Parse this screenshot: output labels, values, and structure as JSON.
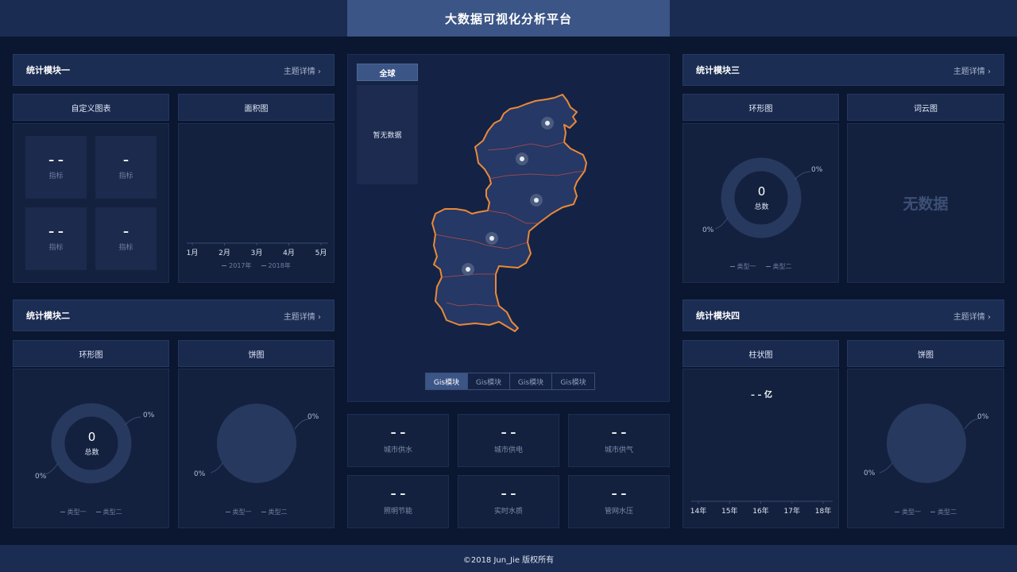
{
  "header": {
    "title": "大数据可视化分析平台"
  },
  "footer": {
    "copyright": "©2018 Jun_Jie 版权所有"
  },
  "detail_label": "主题详情",
  "modules": {
    "one": {
      "title": "统计模块一"
    },
    "two": {
      "title": "统计模块二"
    },
    "three": {
      "title": "统计模块三"
    },
    "four": {
      "title": "统计模块四"
    }
  },
  "custom_chart": {
    "title": "自定义图表",
    "metrics": [
      {
        "value": "– –",
        "label": "指标"
      },
      {
        "value": "–",
        "label": "指标"
      },
      {
        "value": "– –",
        "label": "指标"
      },
      {
        "value": "–",
        "label": "指标"
      }
    ]
  },
  "area_chart": {
    "title": "面积图"
  },
  "ring1": {
    "title": "环形图",
    "value": "0",
    "label": "总数",
    "pct_top": "0%",
    "pct_bottom": "0%"
  },
  "pie1": {
    "title": "饼图",
    "pct_top": "0%",
    "pct_bottom": "0%"
  },
  "ring2": {
    "title": "环形图",
    "value": "0",
    "label": "总数",
    "pct_top": "0%",
    "pct_bottom": "0%"
  },
  "wordcloud": {
    "title": "词云图",
    "empty": "无数据"
  },
  "bar_chart": {
    "title": "柱状图",
    "value_label": "– – 亿"
  },
  "pie2": {
    "title": "饼图",
    "pct_top": "0%",
    "pct_bottom": "0%"
  },
  "legend_types": [
    "类型一",
    "类型二"
  ],
  "map": {
    "region_button": "全球",
    "no_data": "暂无数据",
    "tabs": [
      "Gis模块",
      "Gis模块",
      "Gis模块",
      "Gis模块"
    ]
  },
  "stats": [
    {
      "value": "– –",
      "label": "城市供水"
    },
    {
      "value": "– –",
      "label": "城市供电"
    },
    {
      "value": "– –",
      "label": "城市供气"
    },
    {
      "value": "– –",
      "label": "照明节能"
    },
    {
      "value": "– –",
      "label": "实时水质"
    },
    {
      "value": "– –",
      "label": "管网水压"
    }
  ],
  "colors": {
    "accent": "#3b5586",
    "map_outline": "#e9893a",
    "map_fill": "#263865"
  },
  "chart_data": [
    {
      "type": "area",
      "categories": [
        "1月",
        "2月",
        "3月",
        "4月",
        "5月"
      ],
      "series": [
        {
          "name": "2017年",
          "values": []
        },
        {
          "name": "2018年",
          "values": []
        }
      ]
    },
    {
      "type": "bar",
      "categories": [
        "14年",
        "15年",
        "16年",
        "17年",
        "18年"
      ],
      "values": []
    },
    {
      "type": "pie",
      "series": [
        {
          "name": "类型一",
          "values": []
        },
        {
          "name": "类型二",
          "values": []
        }
      ]
    }
  ]
}
